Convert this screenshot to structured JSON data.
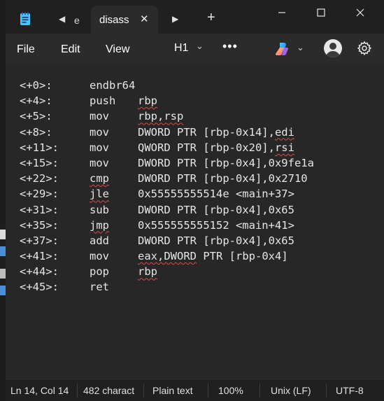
{
  "titlebar": {
    "inactive_tab_label": "e",
    "active_tab_label": "disass",
    "new_tab_symbol": "+"
  },
  "menu": {
    "file": "File",
    "edit": "Edit",
    "view": "View",
    "heading": "H1",
    "more": "•••"
  },
  "editor": {
    "lines": [
      {
        "offset": "<+0>:",
        "mnemonic": "endbr64",
        "operands": "",
        "mn_squiggle": false,
        "op_squiggle": ""
      },
      {
        "offset": "<+4>:",
        "mnemonic": "push",
        "operands": "rbp",
        "mn_squiggle": false,
        "op_squiggle": "all"
      },
      {
        "offset": "<+5>:",
        "mnemonic": "mov",
        "operands": "rbp,rsp",
        "mn_squiggle": false,
        "op_squiggle": "all"
      },
      {
        "offset": "<+8>:",
        "mnemonic": "mov",
        "operands": "DWORD PTR [rbp-0x14],edi",
        "mn_squiggle": false,
        "op_squiggle": "edi"
      },
      {
        "offset": "<+11>:",
        "mnemonic": "mov",
        "operands": "QWORD PTR [rbp-0x20],rsi",
        "mn_squiggle": false,
        "op_squiggle": "rsi"
      },
      {
        "offset": "<+15>:",
        "mnemonic": "mov",
        "operands": "DWORD PTR [rbp-0x4],0x9fe1a",
        "mn_squiggle": false,
        "op_squiggle": ""
      },
      {
        "offset": "<+22>:",
        "mnemonic": "cmp",
        "operands": "DWORD PTR [rbp-0x4],0x2710",
        "mn_squiggle": true,
        "op_squiggle": ""
      },
      {
        "offset": "<+29>:",
        "mnemonic": "jle",
        "operands": "0x55555555514e <main+37>",
        "mn_squiggle": true,
        "op_squiggle": ""
      },
      {
        "offset": "<+31>:",
        "mnemonic": "sub",
        "operands": "DWORD PTR [rbp-0x4],0x65",
        "mn_squiggle": false,
        "op_squiggle": ""
      },
      {
        "offset": "<+35>:",
        "mnemonic": "jmp",
        "operands": "0x555555555152 <main+41>",
        "mn_squiggle": true,
        "op_squiggle": ""
      },
      {
        "offset": "<+37>:",
        "mnemonic": "add",
        "operands": "DWORD PTR [rbp-0x4],0x65",
        "mn_squiggle": false,
        "op_squiggle": ""
      },
      {
        "offset": "<+41>:",
        "mnemonic": "mov",
        "operands": "eax,DWORD PTR [rbp-0x4]",
        "mn_squiggle": false,
        "op_squiggle": "eax,DWORD"
      },
      {
        "offset": "<+44>:",
        "mnemonic": "pop",
        "operands": "rbp",
        "mn_squiggle": false,
        "op_squiggle": "all"
      },
      {
        "offset": "<+45>:",
        "mnemonic": "ret",
        "operands": "",
        "mn_squiggle": false,
        "op_squiggle": ""
      }
    ]
  },
  "statusbar": {
    "position": "Ln 14, Col 14",
    "chars": "482 charact",
    "format": "Plain text",
    "zoom": "100%",
    "line_endings": "Unix (LF)",
    "encoding": "UTF-8"
  },
  "colors": {
    "accent": "#0078d4",
    "squiggle": "#e04848",
    "editor_bg": "#272727",
    "menubar_bg": "#2b2b2b",
    "titlebar_bg": "#202020"
  }
}
